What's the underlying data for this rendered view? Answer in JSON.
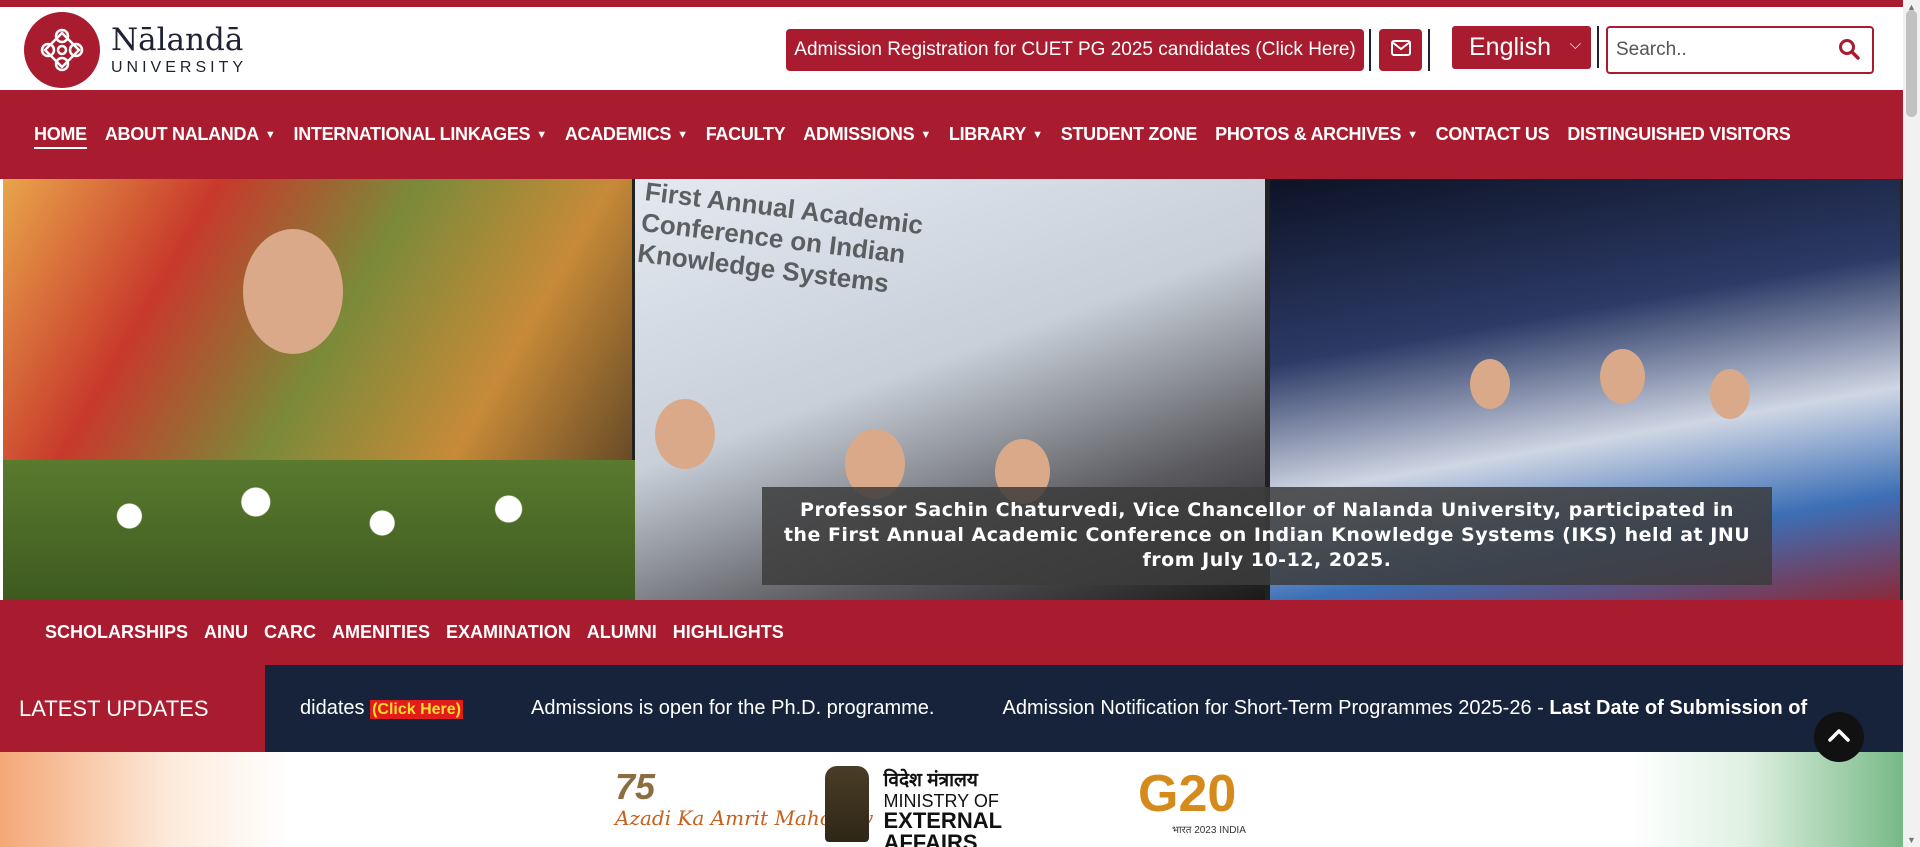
{
  "header": {
    "logo_name": "Nālandā",
    "logo_sub": "UNIVERSITY",
    "admission_button": "Admission Registration for CUET PG 2025 candidates (Click Here)",
    "language_selected": "English",
    "search_placeholder": "Search.."
  },
  "nav": {
    "items": [
      {
        "label": "HOME"
      },
      {
        "label": "ABOUT NALANDA"
      },
      {
        "label": "INTERNATIONAL LINKAGES"
      },
      {
        "label": "ACADEMICS"
      },
      {
        "label": "FACULTY"
      },
      {
        "label": "ADMISSIONS"
      },
      {
        "label": "LIBRARY"
      },
      {
        "label": "STUDENT ZONE"
      },
      {
        "label": "PHOTOS & ARCHIVES"
      },
      {
        "label": "CONTACT US"
      },
      {
        "label": "DISTINGUISHED VISITORS"
      }
    ]
  },
  "banner": {
    "slide_text": "First Annual Academic Conference on Indian Knowledge Systems",
    "caption": "Professor Sachin Chaturvedi, Vice Chancellor of Nalanda University, participated in the First Annual Academic Conference on Indian Knowledge Systems (IKS) held at JNU from July 10-12, 2025."
  },
  "subnav": {
    "items": [
      "SCHOLARSHIPS",
      "AINU",
      "CARC",
      "AMENITIES",
      "EXAMINATION",
      "ALUMNI",
      "HIGHLIGHTS"
    ]
  },
  "updates": {
    "label": "LATEST UPDATES",
    "item1_text": "didates ",
    "item1_link": "(Click Here)",
    "item2_text": "Admissions is open for the Ph.D. programme.",
    "item3_text": "Admission Notification for Short-Term Programmes 2025-26 - ",
    "item3_bold": "Last Date of Submission of"
  },
  "partner_logos": {
    "azadi_num": "75",
    "azadi_text": "Azadi Ka Amrit Mahotsav",
    "mea_hindi": "विदेश मंत्रालय",
    "mea_line1": "MINISTRY OF",
    "mea_line2": "EXTERNAL AFFAIRS",
    "g20_text": "G20",
    "g20_sub": "भारत 2023 INDIA"
  }
}
